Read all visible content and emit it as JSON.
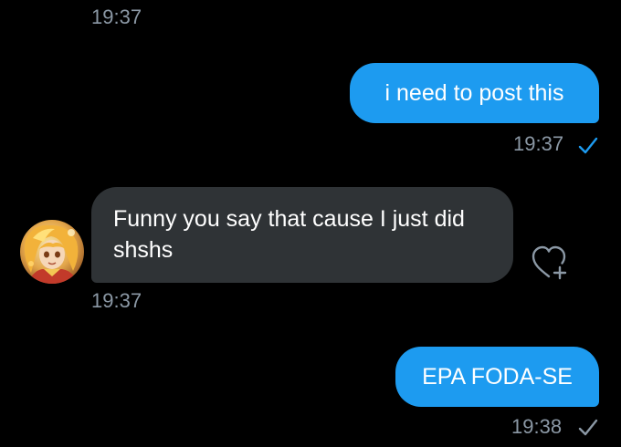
{
  "messages": [
    {
      "timestamp": "19:37"
    },
    {
      "text": "i need to post this",
      "timestamp": "19:37"
    },
    {
      "text": "Funny you say that cause I just did shshs",
      "timestamp": "19:37"
    },
    {
      "text": "EPA FODA-SE",
      "timestamp": "19:38"
    }
  ],
  "colors": {
    "background": "#000000",
    "outgoing_bubble": "#1d9bf0",
    "incoming_bubble": "#2f3336",
    "timestamp": "#8b98a5",
    "seen_check_blue": "#1d9bf0",
    "sent_check_gray": "#8b98a5"
  },
  "icons": {
    "read_receipt_blue": "check-icon",
    "read_receipt_gray": "check-icon",
    "react": "heart-plus-icon",
    "avatar": "anime-character-avatar"
  }
}
